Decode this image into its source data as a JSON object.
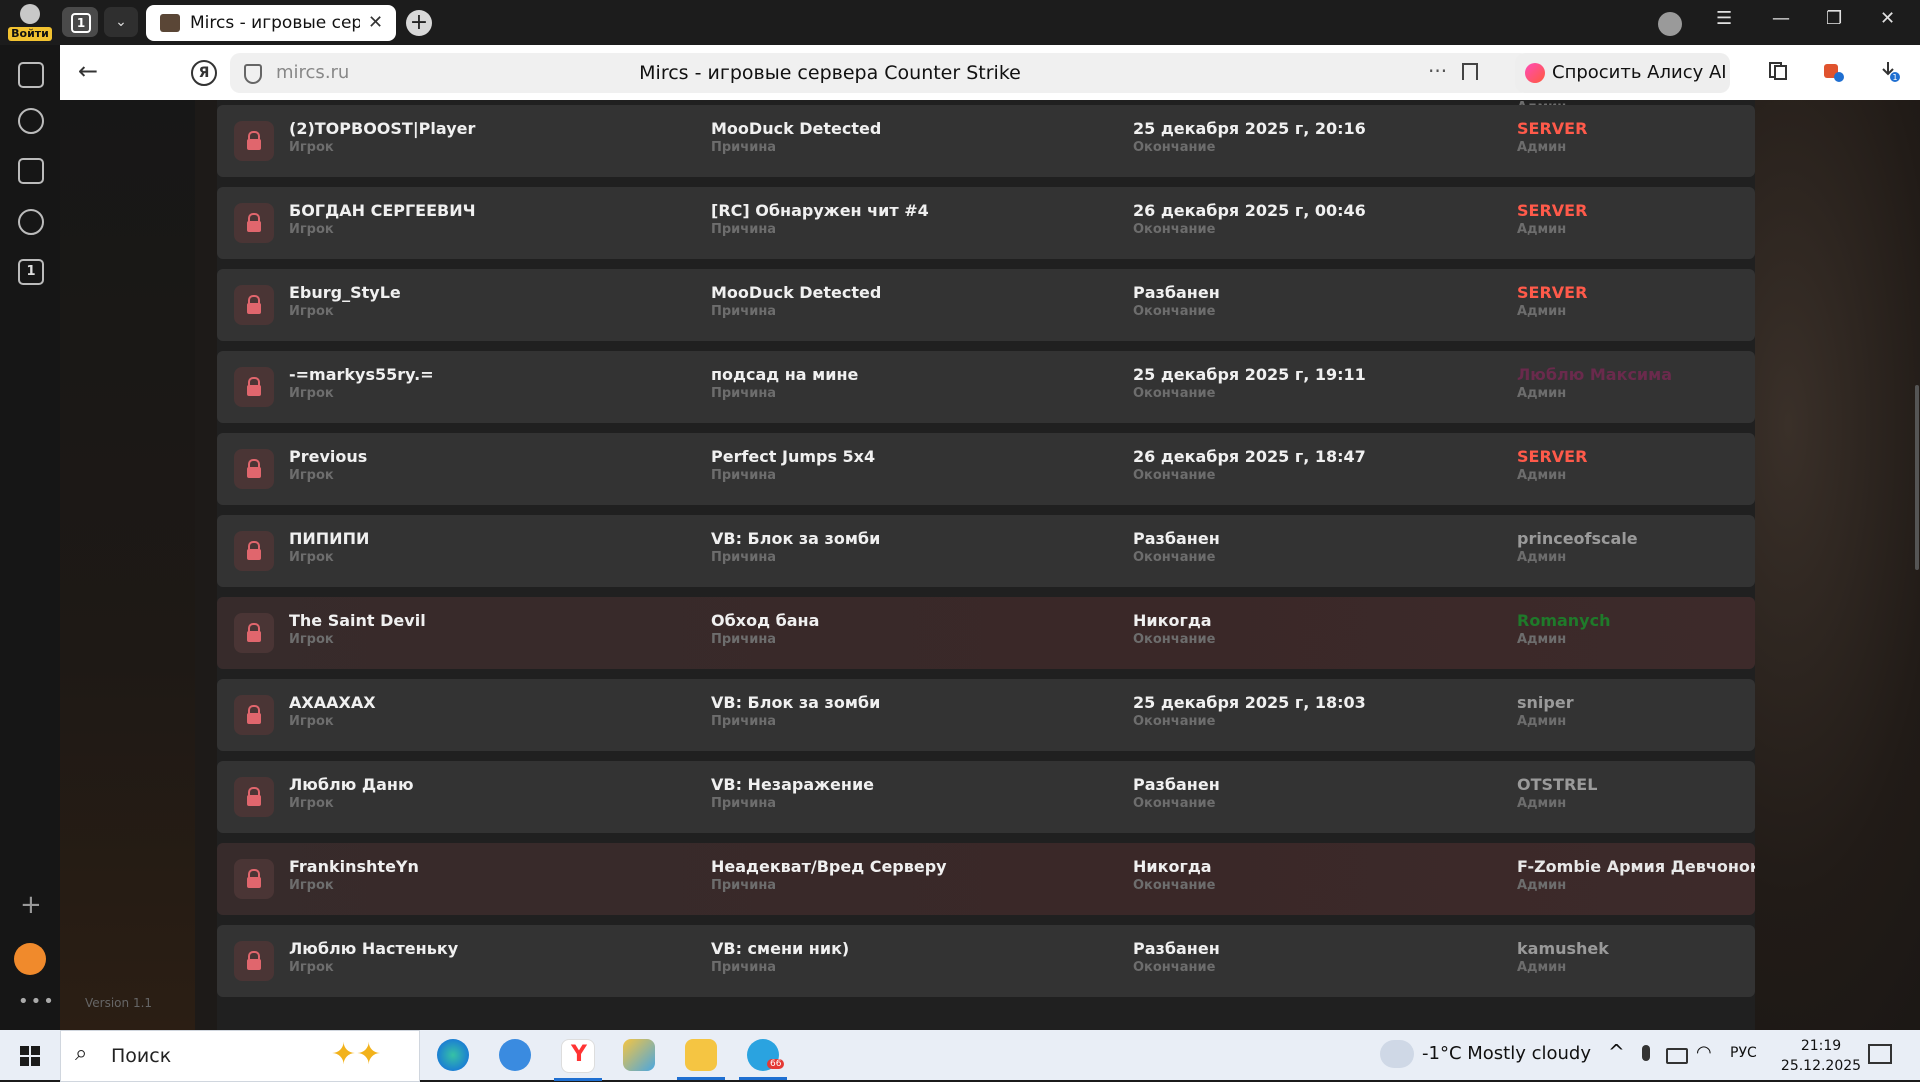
{
  "browser": {
    "login_label": "Войти",
    "tab_count": "1",
    "active_tab_title": "Mircs - игровые серверa Counter Strike",
    "address": {
      "domain": "mircs.ru",
      "page_title": "Mircs - игровые сервера Counter Strike"
    },
    "alice_button_label": "Спросить Алису AI",
    "downloads_badge": "1",
    "sidebar_tab_count": "1"
  },
  "page": {
    "version_label": "Version 1.1",
    "field_labels": {
      "player": "Игрок",
      "reason": "Причина",
      "end": "Окончание",
      "admin": "Админ"
    },
    "partial_top_admin_label": "Админ",
    "rows": [
      {
        "player": "(2)TOPBOOST|Player",
        "reason": "MooDuck Detected",
        "end": "25 декабря 2025 г, 20:16",
        "admin": "SERVER",
        "admin_color": "#ff5a4a",
        "permanent": false
      },
      {
        "player": "БОГДАН СЕРГЕЕВИЧ",
        "reason": "[RC] Обнаружен чит #4",
        "end": "26 декабря 2025 г, 00:46",
        "admin": "SERVER",
        "admin_color": "#ff5a4a",
        "permanent": false
      },
      {
        "player": "Eburg_StyLe",
        "reason": "MooDuck Detected",
        "end": "Разбанен",
        "admin": "SERVER",
        "admin_color": "#ff5a4a",
        "permanent": false
      },
      {
        "player": "-=markys55ry.=",
        "reason": "подсад на мине",
        "end": "25 декабря 2025 г, 19:11",
        "admin": "Люблю Максима",
        "admin_color": "#6a2a4c",
        "permanent": false
      },
      {
        "player": "Previous",
        "reason": "Perfect Jumps 5x4",
        "end": "26 декабря 2025 г, 18:47",
        "admin": "SERVER",
        "admin_color": "#ff5a4a",
        "permanent": false
      },
      {
        "player": "ПИПИПИ",
        "reason": "VB: Блок за зомби",
        "end": "Разбанен",
        "admin": "princeofscale",
        "admin_color": "#9a9a9a",
        "permanent": false
      },
      {
        "player": "The Saint Devil",
        "reason": "Обход бана",
        "end": "Никогда",
        "admin": "Romanych",
        "admin_color": "#1f7a2a",
        "permanent": true
      },
      {
        "player": "AXAAXAX",
        "reason": "VB: Блок за зомби",
        "end": "25 декабря 2025 г, 18:03",
        "admin": "sniper",
        "admin_color": "#9a9a9a",
        "permanent": false
      },
      {
        "player": "Люблю Даню",
        "reason": "VB: Незаражение",
        "end": "Разбанен",
        "admin": "OTSTREL",
        "admin_color": "#9a9a9a",
        "permanent": false
      },
      {
        "player": "FrankinshteYn",
        "reason": "Неадекват/Вред Серверу",
        "end": "Никогда",
        "admin": "F-Zombie Армия Девчонок",
        "admin_color": "#e8e8e8",
        "permanent": true
      },
      {
        "player": "Люблю Настеньку",
        "reason": "VB: смени ник)",
        "end": "Разбанен",
        "admin": "kamushek",
        "admin_color": "#9a9a9a",
        "permanent": false
      }
    ]
  },
  "taskbar": {
    "search_label": "Поиск",
    "weather": "-1°C  Mostly cloudy",
    "language": "РУС",
    "time": "21:19",
    "date": "25.12.2025",
    "telegram_badge": "66",
    "apps": [
      "edge-icon",
      "messenger-icon",
      "yandex-browser-icon",
      "paint-icon",
      "file-explorer-icon",
      "telegram-icon"
    ]
  }
}
